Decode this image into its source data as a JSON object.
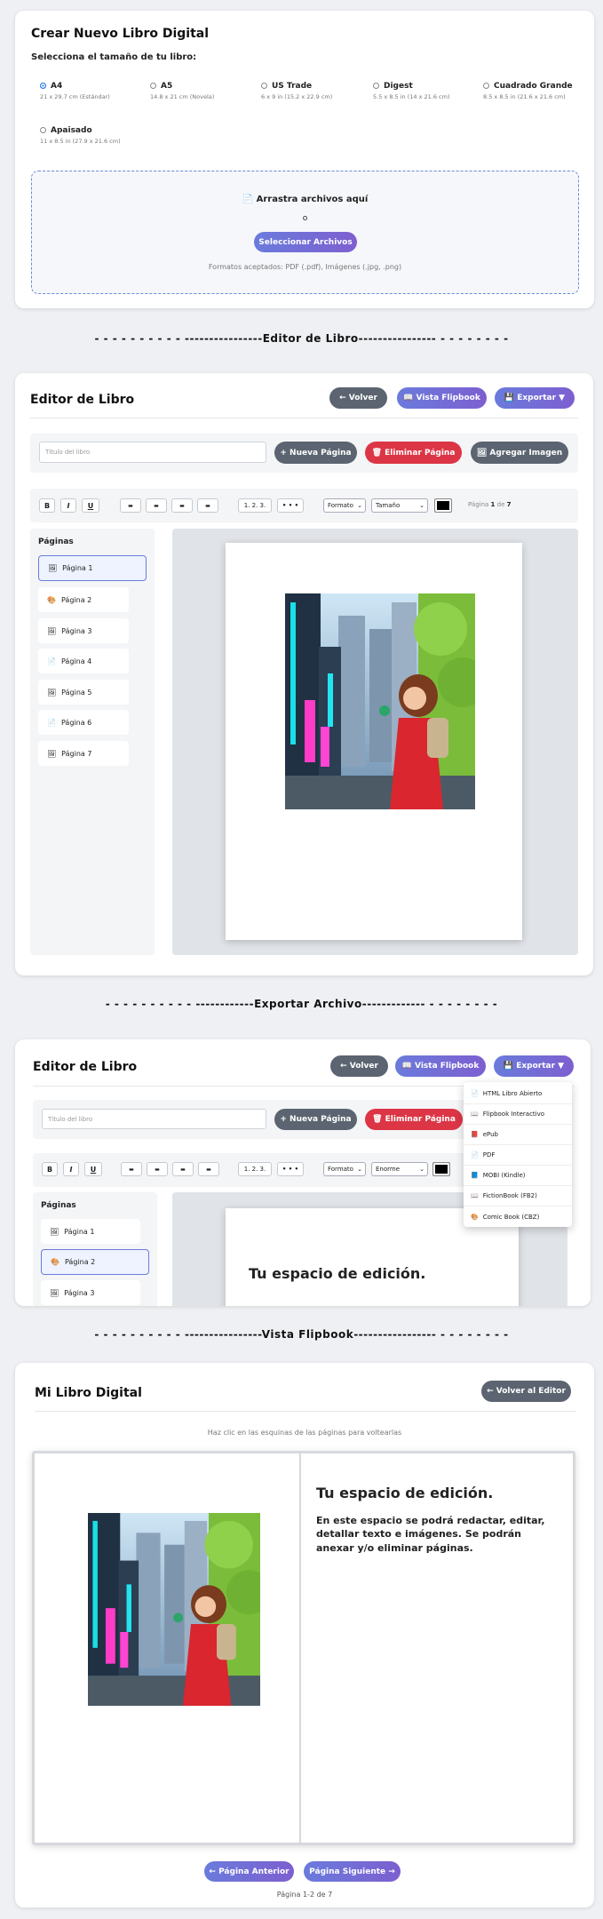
{
  "section1": {
    "title": "Crear Nuevo Libro Digital",
    "size_label": "Selecciona el tamaño de tu libro:",
    "sizes": [
      {
        "name": "A4",
        "dims": "21 x 29.7 cm (Estándar)"
      },
      {
        "name": "A5",
        "dims": "14.8 x 21 cm (Novela)"
      },
      {
        "name": "US Trade",
        "dims": "6 x 9 in (15.2 x 22.9 cm)"
      },
      {
        "name": "Digest",
        "dims": "5.5 x 8.5 in (14 x 21.6 cm)"
      },
      {
        "name": "Cuadrado Grande",
        "dims": "8.5 x 8.5 in (21.6 x 21.6 cm)"
      },
      {
        "name": "Apaisado",
        "dims": "11 x 8.5 in (27.9 x 21.6 cm)"
      }
    ],
    "drop_text": "Arrastra archivos aquí",
    "or_text": "o",
    "select_button": "Seleccionar Archivos",
    "formats": "Formatos aceptados: PDF (.pdf), Imágenes (.jpg, .png)"
  },
  "separators": {
    "editor": "- - - - - - - - - - ----------------Editor de Libro---------------- - - - - - - - -",
    "export": "- - - - - - - - - - ------------Exportar Archivo------------- - - - - - - - -",
    "flipbook": "- - - - - - - - - - ----------------Vista Flipbook----------------- - - - - - - - -"
  },
  "editor": {
    "title": "Editor de Libro",
    "back_button": "← Volver",
    "flipbook_button": "Vista Flipbook",
    "export_button": "Exportar ▼",
    "title_placeholder": "Título del libro",
    "new_page_button": "+ Nueva Página",
    "delete_page_button": "Eliminar Página",
    "add_image_button": "Agregar Imagen",
    "toolbar": {
      "bold": "B",
      "italic": "I",
      "underline": "U",
      "align": [
        "▬",
        "▬",
        "▬",
        "▬"
      ],
      "ordered_list": "1. 2. 3.",
      "bullet_list": "• • •",
      "format_select": "Formato",
      "size_select": "Tamaño",
      "size_select_alt": "Enorme",
      "page_info_prefix": "Página",
      "page_current": "1",
      "page_info_mid": "de",
      "page_total": "7"
    },
    "pages_heading": "Páginas",
    "pages": [
      {
        "label": "Página 1",
        "icon": "🖼"
      },
      {
        "label": "Página 2",
        "icon": "🎨"
      },
      {
        "label": "Página 3",
        "icon": "🖼"
      },
      {
        "label": "Página 4",
        "icon": "📄"
      },
      {
        "label": "Página 5",
        "icon": "🖼"
      },
      {
        "label": "Página 6",
        "icon": "📄"
      },
      {
        "label": "Página 7",
        "icon": "🖼"
      }
    ],
    "canvas_heading": "Tu espacio de edición."
  },
  "export_menu": [
    {
      "label": "HTML Libro Abierto",
      "icon": "📄"
    },
    {
      "label": "Flipbook Interactivo",
      "icon": "📖"
    },
    {
      "label": "ePub",
      "icon": "📕"
    },
    {
      "label": "PDF",
      "icon": "📄"
    },
    {
      "label": "MOBI (Kindle)",
      "icon": "📘"
    },
    {
      "label": "FictionBook (FB2)",
      "icon": "📖"
    },
    {
      "label": "Comic Book (CBZ)",
      "icon": "🎨"
    }
  ],
  "flipbook": {
    "title": "Mi Libro Digital",
    "back_button": "← Volver al Editor",
    "hint": "Haz clic en las esquinas de las páginas para voltearlas",
    "right_heading": "Tu espacio de edición.",
    "right_body": "En este espacio se podrá redactar, editar, detallar texto e imágenes. Se podrán anexar y/o eliminar páginas.",
    "prev_button": "← Página Anterior",
    "next_button": "Página Siguiente →",
    "page_info": "Página 1-2 de 7"
  },
  "colors": {
    "accent": "#6a7bdc",
    "danger": "#dc3545",
    "neutral": "#5b6470"
  }
}
